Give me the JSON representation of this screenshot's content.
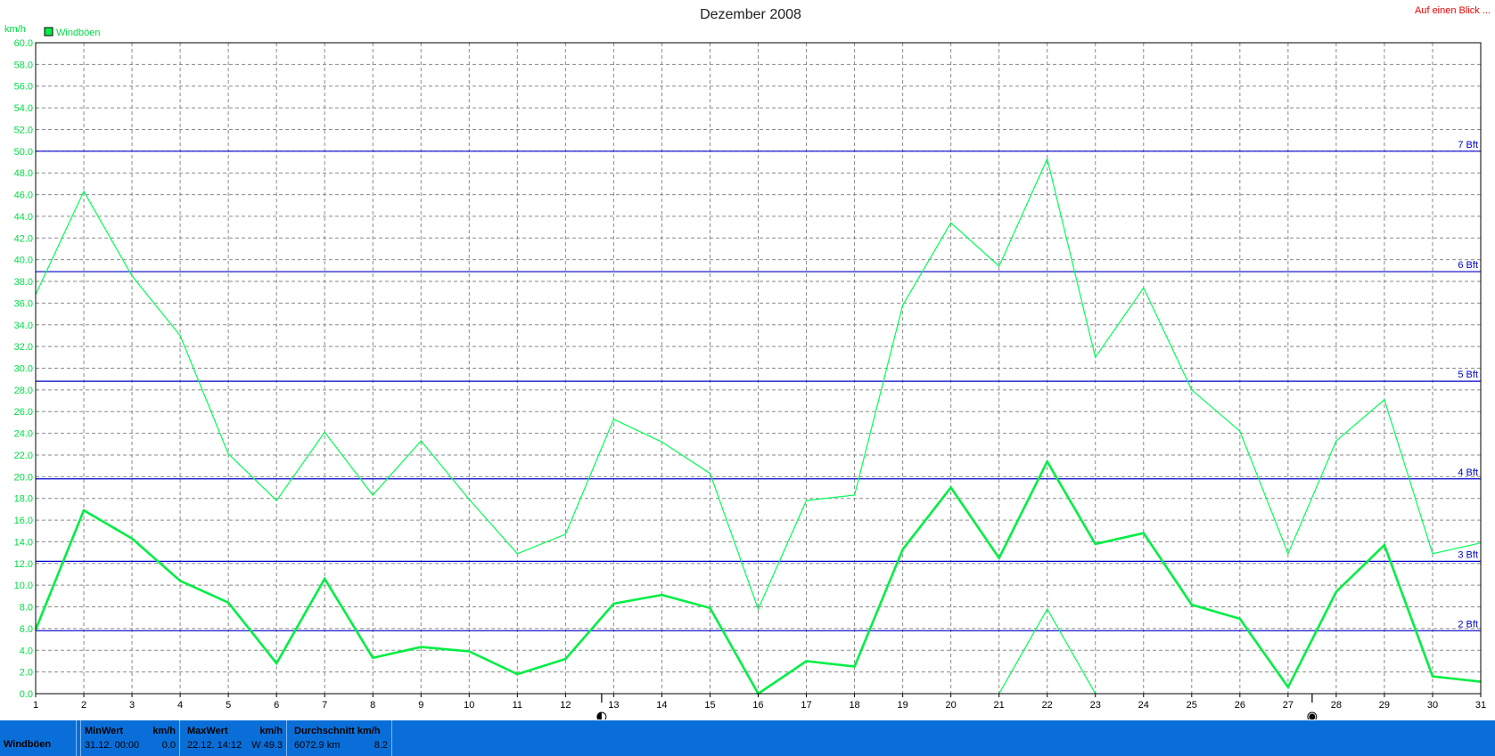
{
  "link": {
    "overview_label": "Auf einen Blick ..."
  },
  "colors": {
    "gust_line": "#00ff55",
    "avg_line": "#00ee44",
    "bft_line": "#0000cc",
    "axis_text": "#00dd44",
    "grid": "#8a8a8a",
    "status_bar": "#0a6ed8"
  },
  "chart_data": {
    "type": "line",
    "title": "Dezember 2008",
    "ylabel": "km/h",
    "ylim": [
      0,
      60
    ],
    "y_ticks": [
      "0.0",
      "2.0",
      "4.0",
      "6.0",
      "8.0",
      "10.0",
      "12.0",
      "14.0",
      "16.0",
      "18.0",
      "20.0",
      "22.0",
      "24.0",
      "26.0",
      "28.0",
      "30.0",
      "32.0",
      "34.0",
      "36.0",
      "38.0",
      "40.0",
      "42.0",
      "44.0",
      "46.0",
      "48.0",
      "50.0",
      "52.0",
      "54.0",
      "56.0",
      "58.0",
      "60.0"
    ],
    "x": [
      1,
      2,
      3,
      4,
      5,
      6,
      7,
      8,
      9,
      10,
      11,
      12,
      13,
      14,
      15,
      16,
      17,
      18,
      19,
      20,
      21,
      22,
      23,
      24,
      25,
      26,
      27,
      28,
      29,
      30,
      31
    ],
    "grid": true,
    "legend": {
      "position": "top-left",
      "entries": [
        "Windböen"
      ]
    },
    "series": [
      {
        "name": "Windböen",
        "role": "max",
        "values": [
          36.8,
          46.3,
          38.5,
          33.0,
          22.1,
          17.8,
          24.1,
          18.3,
          23.3,
          17.9,
          12.9,
          14.7,
          25.3,
          23.2,
          20.3,
          7.8,
          17.8,
          18.3,
          35.8,
          43.4,
          39.4,
          49.3,
          31.0,
          37.4,
          28.0,
          24.2,
          12.9,
          23.3,
          27.1,
          12.9,
          13.9
        ]
      },
      {
        "role": "average",
        "values": [
          5.9,
          16.9,
          14.3,
          10.4,
          8.4,
          2.8,
          10.6,
          3.3,
          4.3,
          3.9,
          1.8,
          3.2,
          8.3,
          9.1,
          7.9,
          0.0,
          3.0,
          2.5,
          13.3,
          19.0,
          12.5,
          21.4,
          13.8,
          14.8,
          8.2,
          6.9,
          0.6,
          9.4,
          13.7,
          1.6,
          1.1
        ]
      },
      {
        "role": "min",
        "points": [
          [
            21,
            0.0
          ],
          [
            22,
            7.8
          ],
          [
            23,
            0.0
          ]
        ]
      }
    ],
    "reference_lines": [
      {
        "label": "2 Bft",
        "value": 5.8
      },
      {
        "label": "3 Bft",
        "value": 12.2
      },
      {
        "label": "4 Bft",
        "value": 19.8
      },
      {
        "label": "5 Bft",
        "value": 28.8
      },
      {
        "label": "6 Bft",
        "value": 38.9
      },
      {
        "label": "7 Bft",
        "value": 50.0
      }
    ],
    "moon_phases": [
      {
        "day": 12.75,
        "phase": "first-quarter"
      },
      {
        "day": 27.5,
        "phase": "new-moon"
      }
    ]
  },
  "stats": {
    "series_label": "Windböen",
    "min": {
      "header": "MinWert",
      "unit": "km/h",
      "when": "31.12.  00:00",
      "value": "0.0"
    },
    "max": {
      "header": "MaxWert",
      "unit": "km/h",
      "when": "22.12.  14:12",
      "dir": "W",
      "value": "49.3"
    },
    "avg": {
      "header": "Durchschnitt km/h",
      "distance": "6072.9 km",
      "value": "8.2"
    }
  }
}
